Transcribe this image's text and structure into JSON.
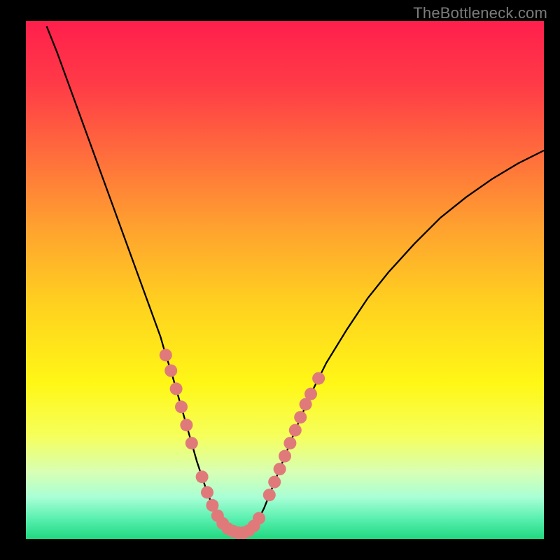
{
  "watermark": "TheBottleneck.com",
  "chart_data": {
    "type": "line",
    "title": "",
    "xlabel": "",
    "ylabel": "",
    "xlim": [
      0,
      100
    ],
    "ylim": [
      0,
      100
    ],
    "grid": false,
    "series": [
      {
        "name": "curve",
        "x": [
          4,
          6,
          8,
          10,
          12,
          14,
          16,
          18,
          20,
          22,
          24,
          26,
          27,
          28,
          29,
          30,
          31,
          32,
          33,
          34,
          35,
          36,
          37,
          38,
          39,
          40,
          41,
          42,
          43,
          44,
          45,
          46,
          47,
          48,
          50,
          52,
          55,
          58,
          62,
          66,
          70,
          75,
          80,
          85,
          90,
          95,
          100
        ],
        "y": [
          99,
          94,
          88.5,
          83,
          77.5,
          72,
          66.5,
          61,
          55.5,
          50,
          44.5,
          39,
          35.5,
          32.5,
          29,
          25.5,
          22,
          18.5,
          15,
          12,
          9,
          6.5,
          4.5,
          3,
          2,
          1.5,
          1.2,
          1.2,
          1.6,
          2.5,
          4,
          6,
          8.5,
          11,
          16,
          21,
          28,
          34,
          40.5,
          46.5,
          51.5,
          57,
          62,
          66,
          69.5,
          72.5,
          75
        ]
      }
    ],
    "markers": {
      "name": "highlight-dots",
      "color": "#e07a7a",
      "points": [
        {
          "x": 27,
          "y": 35.5
        },
        {
          "x": 28,
          "y": 32.5
        },
        {
          "x": 29,
          "y": 29
        },
        {
          "x": 30,
          "y": 25.5
        },
        {
          "x": 31,
          "y": 22
        },
        {
          "x": 32,
          "y": 18.5
        },
        {
          "x": 34,
          "y": 12
        },
        {
          "x": 35,
          "y": 9
        },
        {
          "x": 36,
          "y": 6.5
        },
        {
          "x": 37,
          "y": 4.5
        },
        {
          "x": 38,
          "y": 3
        },
        {
          "x": 39,
          "y": 2
        },
        {
          "x": 40,
          "y": 1.5
        },
        {
          "x": 41,
          "y": 1.2
        },
        {
          "x": 42,
          "y": 1.2
        },
        {
          "x": 43,
          "y": 1.6
        },
        {
          "x": 44,
          "y": 2.5
        },
        {
          "x": 45,
          "y": 4
        },
        {
          "x": 47,
          "y": 8.5
        },
        {
          "x": 48,
          "y": 11
        },
        {
          "x": 49,
          "y": 13.5
        },
        {
          "x": 50,
          "y": 16
        },
        {
          "x": 51,
          "y": 18.5
        },
        {
          "x": 52,
          "y": 21
        },
        {
          "x": 53,
          "y": 23.5
        },
        {
          "x": 54,
          "y": 26
        },
        {
          "x": 55,
          "y": 28
        },
        {
          "x": 56.5,
          "y": 31
        }
      ]
    },
    "gradient_stops": [
      {
        "offset": 0.0,
        "color": "#ff1f4c"
      },
      {
        "offset": 0.12,
        "color": "#ff3a47"
      },
      {
        "offset": 0.25,
        "color": "#ff6a3d"
      },
      {
        "offset": 0.4,
        "color": "#ffa22f"
      },
      {
        "offset": 0.55,
        "color": "#ffd21f"
      },
      {
        "offset": 0.7,
        "color": "#fff716"
      },
      {
        "offset": 0.8,
        "color": "#f6ff5a"
      },
      {
        "offset": 0.87,
        "color": "#d8ffb3"
      },
      {
        "offset": 0.92,
        "color": "#a8ffd5"
      },
      {
        "offset": 0.96,
        "color": "#5af0b0"
      },
      {
        "offset": 1.0,
        "color": "#20d880"
      }
    ]
  }
}
